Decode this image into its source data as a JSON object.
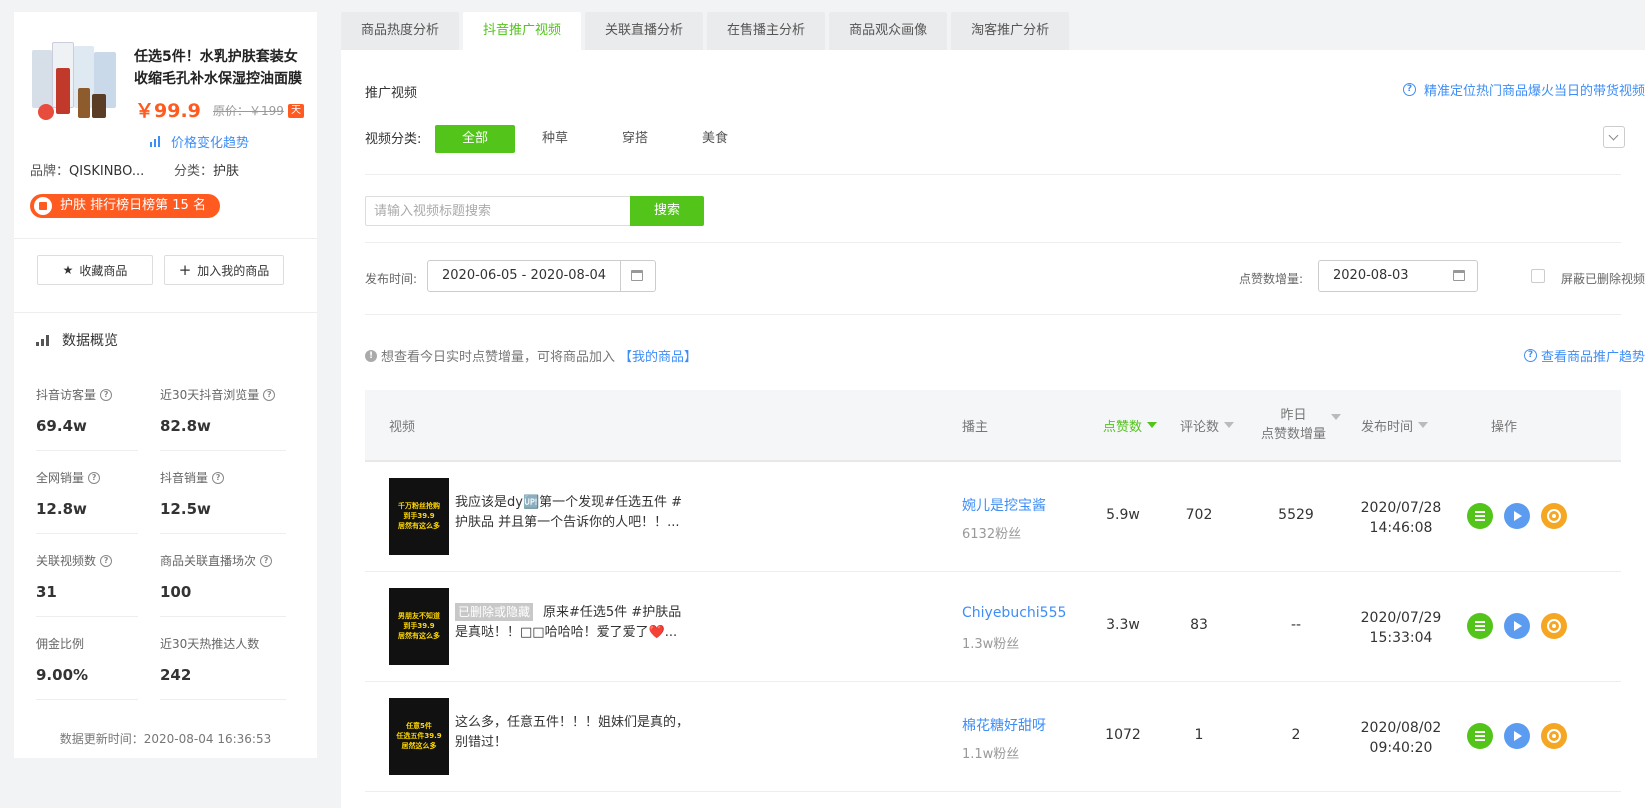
{
  "product": {
    "title_line1": "任选5件！水乳护肤套装女",
    "title_line2": "收缩毛孔补水保湿控油面膜",
    "price": "￥99.9",
    "original_price": "原价：￥199",
    "platform_badge": "天",
    "price_trend_label": "价格变化趋势",
    "brand_label": "品牌：",
    "brand_value": "QISKINBO...",
    "category_label": "分类：",
    "category_value": "护肤",
    "rank_text": "护肤 排行榜日榜第 15 名",
    "favorite_label": "收藏商品",
    "add_mine_label": "加入我的商品"
  },
  "overview": {
    "title": "数据概览",
    "stats": [
      {
        "label": "抖音访客量",
        "value": "69.4w"
      },
      {
        "label": "近30天抖音浏览量",
        "value": "82.8w"
      },
      {
        "label": "全网销量",
        "value": "12.8w"
      },
      {
        "label": "抖音销量",
        "value": "12.5w"
      },
      {
        "label": "关联视频数",
        "value": "31"
      },
      {
        "label": "商品关联直播场次",
        "value": "100"
      },
      {
        "label": "佣金比例",
        "value": "9.00%"
      },
      {
        "label": "近30天热推达人数",
        "value": "242"
      }
    ],
    "updated": "数据更新时间：2020-08-04 16:36:53"
  },
  "tabs": [
    "商品热度分析",
    "抖音推广视频",
    "关联直播分析",
    "在售播主分析",
    "商品观众画像",
    "淘客推广分析"
  ],
  "main": {
    "section_title": "推广视频",
    "hint_link": "精准定位热门商品爆火当日的带货视频",
    "category_label": "视频分类:",
    "categories": [
      "全部",
      "种草",
      "穿搭",
      "美食"
    ],
    "search_placeholder": "请输入视频标题搜索",
    "search_button": "搜索",
    "publish_label": "发布时间:",
    "publish_range": "2020-06-05 - 2020-08-04",
    "likes_inc_label": "点赞数增量:",
    "likes_inc_date": "2020-08-03",
    "hide_deleted": "屏蔽已删除视频",
    "info_text": "想查看今日实时点赞增量，可将商品加入",
    "info_link": "【我的商品】",
    "trend_link": "查看商品推广趋势"
  },
  "table": {
    "headers": {
      "video": "视频",
      "host": "播主",
      "likes": "点赞数",
      "comments": "评论数",
      "yday_line1": "昨日",
      "yday_line2": "点赞数增量",
      "published": "发布时间",
      "actions": "操作"
    },
    "rows": [
      {
        "thumb": [
          "千万粉丝抢购",
          "到手39.9",
          "居然有这么多"
        ],
        "deleted_tag": "",
        "title": "我应该是dy🆙第一个发现#任选五件 #护肤品 并且第一个告诉你的人吧！！...",
        "host": "婉儿是挖宝酱",
        "fans": "6132粉丝",
        "likes": "5.9w",
        "comments": "702",
        "yday": "5529",
        "date": "2020/07/28",
        "time": "14:46:08"
      },
      {
        "thumb": [
          "男朋友不知道",
          "到手39.9",
          "居然有这么多"
        ],
        "deleted_tag": "已删除或隐藏",
        "title": "原来#任选5件 #护肤品 是真哒！！□□哈哈哈！爱了爱了❤️...",
        "host": "Chiyebuchi555",
        "fans": "1.3w粉丝",
        "likes": "3.3w",
        "comments": "83",
        "yday": "--",
        "date": "2020/07/29",
        "time": "15:33:04"
      },
      {
        "thumb": [
          "任意5件",
          "任选五件39.9",
          "居然这么多"
        ],
        "deleted_tag": "",
        "title": "这么多，任意五件！！！姐妹们是真的，别错过！",
        "host": "棉花糖好甜呀",
        "fans": "1.1w粉丝",
        "likes": "1072",
        "comments": "1",
        "yday": "2",
        "date": "2020/08/02",
        "time": "09:40:20"
      }
    ]
  },
  "colors": {
    "accent_green": "#52c41a",
    "link_blue": "#3e8ef7",
    "price_orange": "#ff5a1f",
    "play_blue": "#5b9cf0",
    "target_orange": "#f5a623"
  },
  "icons": [
    "chart-icon",
    "star-icon",
    "plus-icon",
    "question-icon",
    "calendar-icon",
    "info-icon",
    "detail-icon",
    "play-icon",
    "target-icon",
    "sort-down-icon",
    "chevron-down-icon",
    "rank-bag-icon"
  ]
}
